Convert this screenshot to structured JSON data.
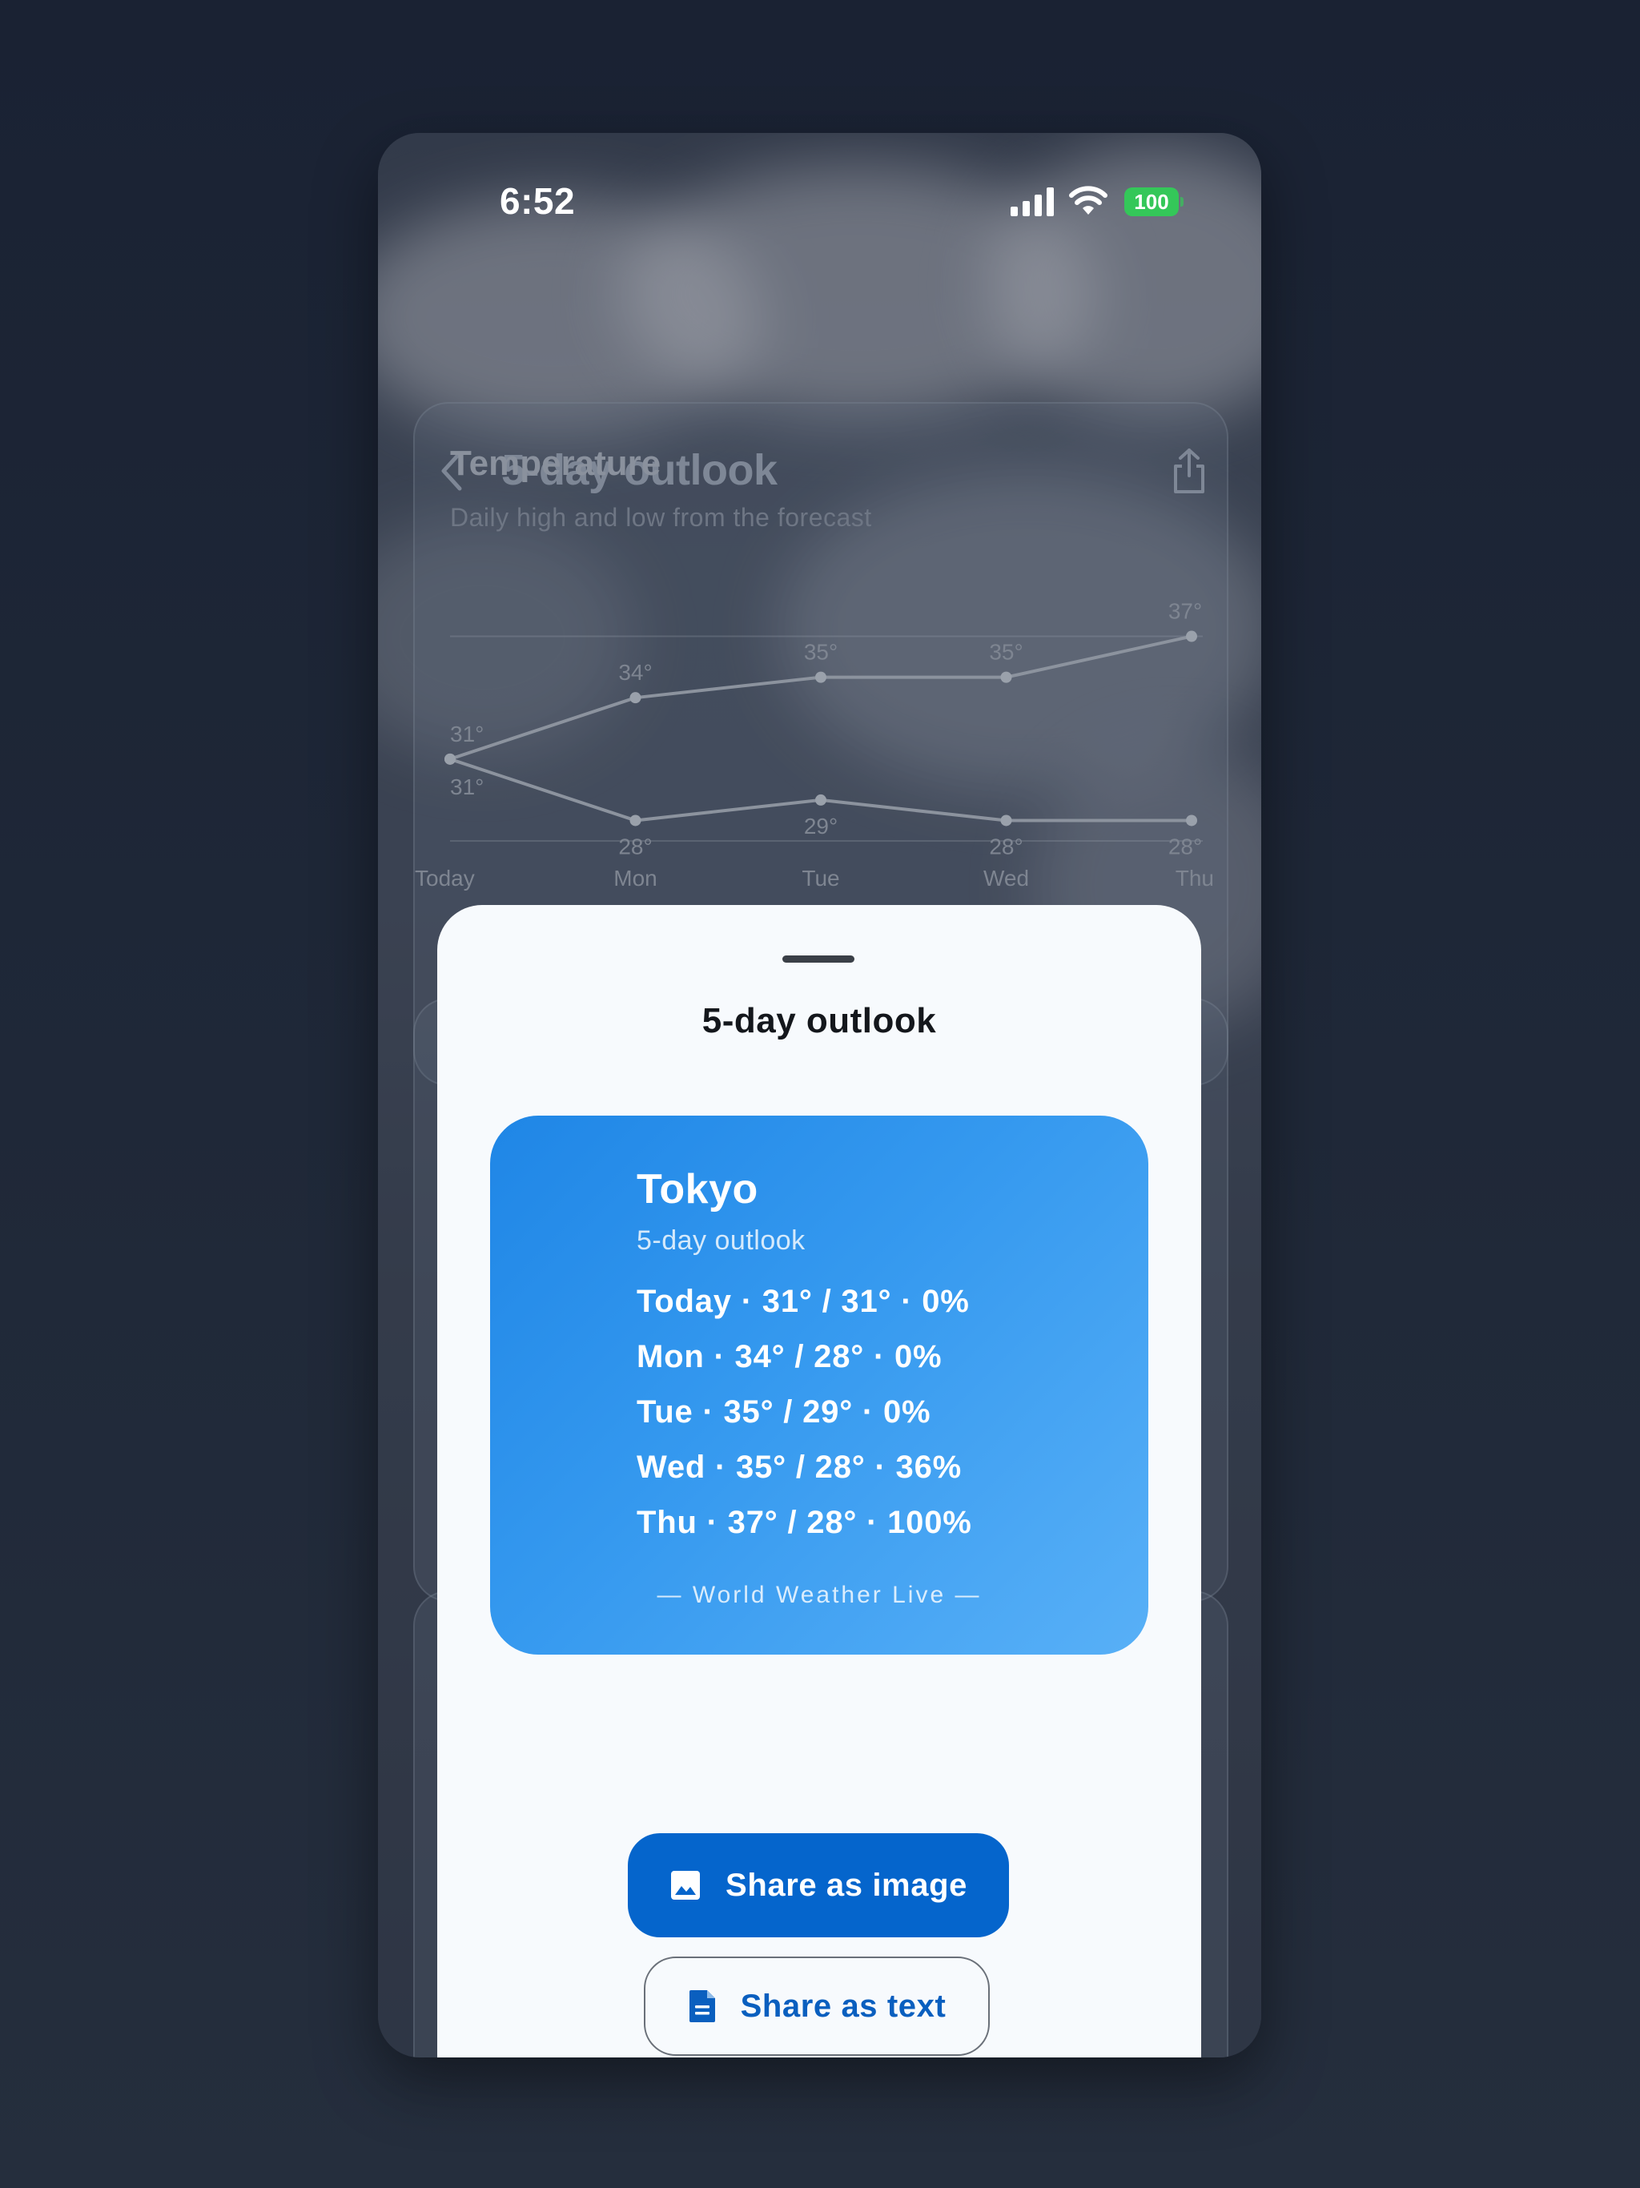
{
  "status_bar": {
    "time": "6:52",
    "battery": "100",
    "signal_icon": "cellular-signal-icon",
    "wifi_icon": "wifi-icon"
  },
  "nav": {
    "title": "5-day outlook",
    "back_icon": "chevron-left-icon",
    "share_icon": "share-icon"
  },
  "temperature_card": {
    "title": "Temperature",
    "subtitle": "Daily high and low from the forecast"
  },
  "chart_data": {
    "type": "line",
    "title": "Temperature",
    "subtitle": "Daily high and low from the forecast",
    "categories": [
      "Today",
      "Mon",
      "Tue",
      "Wed",
      "Thu"
    ],
    "series": [
      {
        "values": [
          31,
          34,
          35,
          35,
          37
        ],
        "labels": [
          "31°",
          "34°",
          "35°",
          "35°",
          "37°"
        ]
      },
      {
        "values": [
          31,
          28,
          29,
          28,
          28
        ],
        "labels": [
          "31°",
          "28°",
          "29°",
          "28°",
          "28°"
        ]
      }
    ],
    "ylim": [
      27,
      38
    ],
    "grid": true
  },
  "sheet": {
    "title": "5-day outlook",
    "preview": {
      "city": "Tokyo",
      "subtitle": "5-day outlook",
      "rows": [
        "Today · 31° / 31° · 0%",
        "Mon · 34° / 28° · 0%",
        "Tue · 35° / 29° · 0%",
        "Wed · 35° / 28° · 36%",
        "Thu · 37° / 28° · 100%"
      ],
      "brand": "— World Weather Live —"
    },
    "share_image_label": "Share as image",
    "share_image_icon": "image-icon",
    "share_text_label": "Share as text",
    "share_text_icon": "document-icon",
    "accent": "#0565cc"
  }
}
